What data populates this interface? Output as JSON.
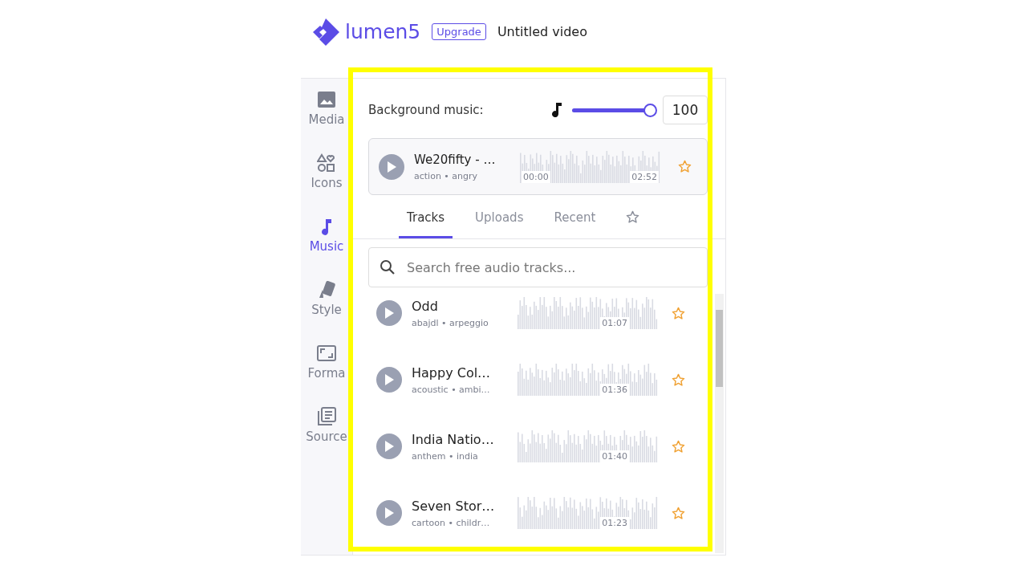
{
  "header": {
    "logo_text": "lumen5",
    "upgrade_button": "Upgrade",
    "video_title": "Untitled video"
  },
  "sidebar": {
    "items": [
      {
        "label": "Media",
        "kind": "media",
        "selected": false
      },
      {
        "label": "Icons",
        "kind": "icons",
        "selected": false
      },
      {
        "label": "Music",
        "kind": "music",
        "selected": true
      },
      {
        "label": "Style",
        "kind": "style",
        "selected": false
      },
      {
        "label": "Forma",
        "kind": "format",
        "selected": false
      },
      {
        "label": "Source",
        "kind": "source",
        "selected": false
      }
    ]
  },
  "background_music": {
    "label": "Background music:",
    "level": 1.0,
    "value": "100"
  },
  "current_track": {
    "title": "We20fifty - …",
    "tags": "action • angry",
    "start_time": "00:00",
    "end_time": "02:52",
    "starred": false
  },
  "tabs": [
    {
      "label": "Tracks",
      "kind": "text",
      "selected": true
    },
    {
      "label": "Uploads",
      "kind": "text",
      "selected": false
    },
    {
      "label": "Recent",
      "kind": "text",
      "selected": false
    },
    {
      "kind": "star",
      "selected": false
    }
  ],
  "search": {
    "placeholder": "Search free audio tracks..."
  },
  "tracks": [
    {
      "title": "Odd",
      "tags": "abajdl • arpeggio",
      "duration": "01:07",
      "starred": false
    },
    {
      "title": "Happy Col…",
      "tags": "acoustic • ambi…",
      "duration": "01:36",
      "starred": false
    },
    {
      "title": "India Natio…",
      "tags": "anthem • india",
      "duration": "01:40",
      "starred": false
    },
    {
      "title": "Seven Stor…",
      "tags": "cartoon • childr…",
      "duration": "01:23",
      "starred": false
    }
  ]
}
